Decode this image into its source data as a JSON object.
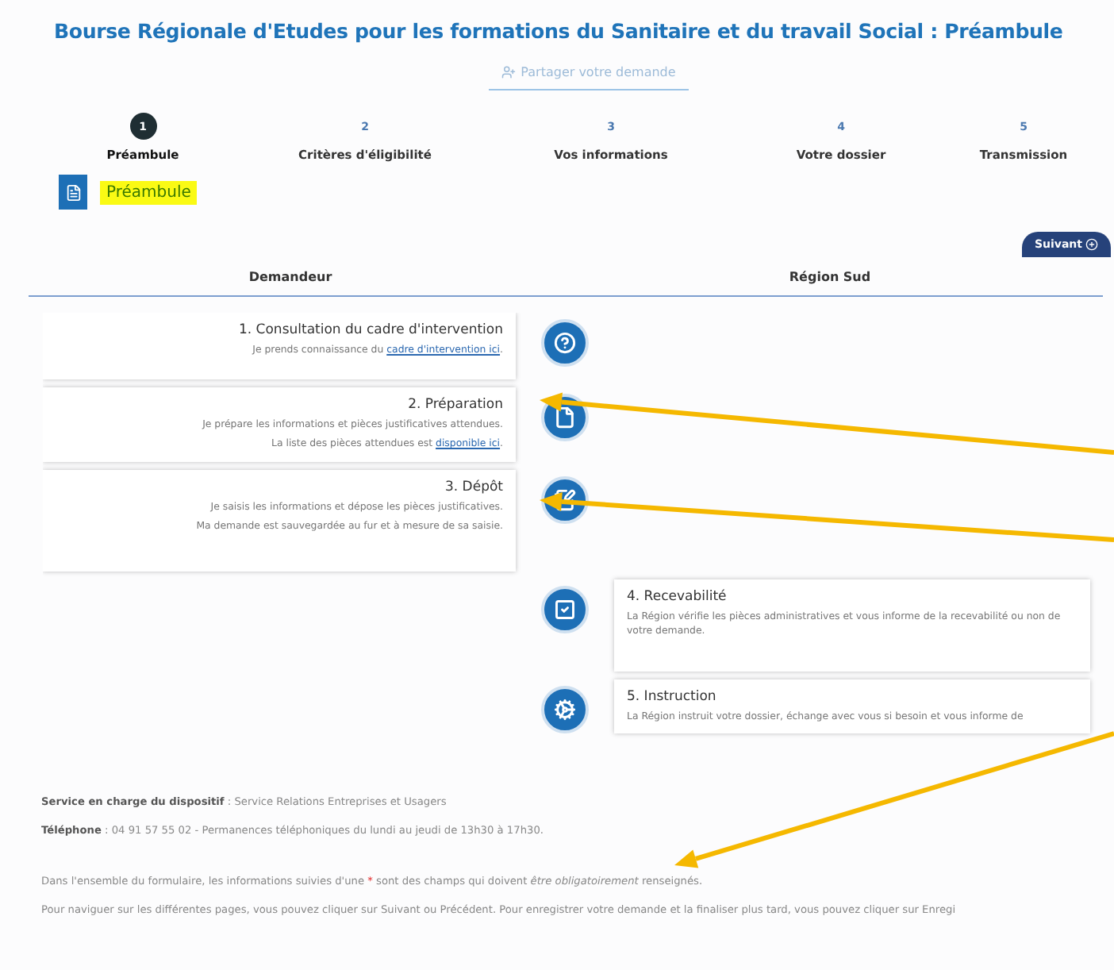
{
  "title": "Bourse Régionale d'Etudes pour les formations du Sanitaire et du travail Social : Préambule",
  "share_button": "Partager votre demande",
  "steps": [
    {
      "number": "1",
      "label": "Préambule",
      "selected": true
    },
    {
      "number": "2",
      "label": "Critères d'éligibilité",
      "selected": false
    },
    {
      "number": "3",
      "label": "Vos informations",
      "selected": false
    },
    {
      "number": "4",
      "label": "Votre dossier",
      "selected": false
    },
    {
      "number": "5",
      "label": "Transmission",
      "selected": false
    }
  ],
  "section_title": "Préambule",
  "next_button": "Suivant",
  "columns": [
    "Demandeur",
    "Région Sud"
  ],
  "process": [
    {
      "kind": "demandeur",
      "title": "1. Consultation du cadre d'intervention",
      "lines": [
        {
          "text": "Je prends connaissance du ",
          "link": "cadre d'intervention ici",
          "after": "."
        }
      ]
    },
    {
      "kind": "demandeur",
      "title": "2. Préparation",
      "lines": [
        {
          "text": "Je prépare les informations et pièces justificatives attendues."
        },
        {
          "text": "La liste des pièces attendues est ",
          "link": "disponible ici",
          "after": "."
        }
      ]
    },
    {
      "kind": "demandeur",
      "title": "3. Dépôt",
      "lines": [
        {
          "text": "Je saisis les informations et dépose les pièces justificatives."
        },
        {
          "text": "Ma demande est sauvegardée au fur et à mesure de sa saisie."
        }
      ]
    },
    {
      "kind": "region",
      "title": "4. Recevabilité",
      "lines": [
        {
          "text": "La Région vérifie les pièces administratives et vous informe de la recevabilité ou non de votre demande."
        }
      ]
    },
    {
      "kind": "region",
      "title": "5. Instruction",
      "lines": [
        {
          "text": "La Région instruit votre dossier, échange avec vous si besoin et vous informe de"
        }
      ]
    }
  ],
  "contact": [
    "**Service en charge du dispositif** : Service Relations Entreprises et Usagers",
    "**Téléphone** : 04 91 57 55 02 - Permanences téléphoniques du lundi au jeudi de 13h30 à 17h30."
  ],
  "notes": [
    {
      "before": "Dans l'ensemble du formulaire, les informations suivies d'une ",
      "mark": "*",
      "after": " sont des champs qui doivent *être obligatoirement* renseignés."
    },
    {
      "before": "Pour naviguer sur les différentes pages, vous pouvez cliquer sur Suivant ou Précédent. Pour enregistrer votre demande et la finaliser plus tard, vous pouvez cliquer sur Enregi"
    }
  ]
}
